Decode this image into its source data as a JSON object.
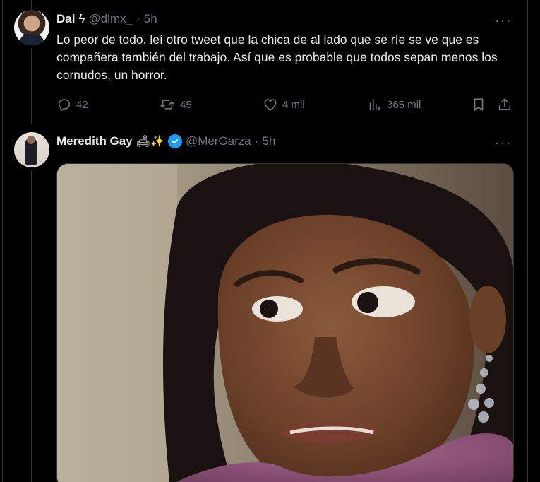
{
  "tweet1": {
    "name": "Dai",
    "badge": "ϟ",
    "handle": "@dlmx_",
    "separator": "·",
    "time": "5h",
    "more": "···",
    "text": "Lo peor de todo, leí otro tweet que la chica de al lado que se ríe se ve que es compañera también del trabajo. Así que es probable que todos sepan menos los cornudos, un horror.",
    "stats": {
      "replies": "42",
      "reposts": "45",
      "likes": "4 mil",
      "views": "365 mil"
    }
  },
  "tweet2": {
    "name": "Meredith Gay",
    "emoji": "🛋✨",
    "handle": "@MerGarza",
    "separator": "·",
    "time": "5h",
    "more": "···"
  },
  "icons": {
    "reply": "reply-icon",
    "repost": "repost-icon",
    "like": "heart-icon",
    "views": "views-chart-icon",
    "bookmark": "bookmark-icon",
    "share": "share-icon",
    "verified": "verified-badge-icon"
  },
  "colors": {
    "background": "#000000",
    "text": "#e7e9ea",
    "muted": "#71767b",
    "verified": "#1d9bf0",
    "border": "#2f3336"
  }
}
